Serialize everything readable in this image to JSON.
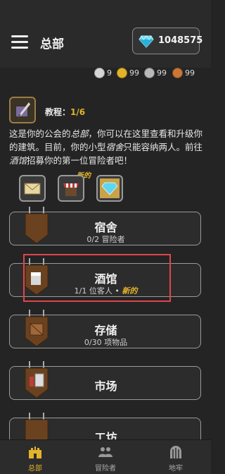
{
  "header": {
    "title": "总部",
    "gems": "1048575"
  },
  "resources": [
    {
      "icon": "silver-skull-coin-icon",
      "value": "9",
      "color": "#cfcfcf"
    },
    {
      "icon": "gold-coin-icon",
      "value": "99",
      "color": "#e3b32a"
    },
    {
      "icon": "silver-coin-icon",
      "value": "99",
      "color": "#b9b9b9"
    },
    {
      "icon": "copper-coin-icon",
      "value": "99",
      "color": "#c9783a"
    }
  ],
  "tutorial": {
    "label": "教程：",
    "progress": "1/6",
    "desc": {
      "p1": "这是你的公会的",
      "hq": "总部",
      "p2": "，你可以在这里查看和升级你的建筑。目前，你的小型",
      "dorm": "宿舍",
      "p3": "只能容纳两人。前往",
      "tavern": "酒馆",
      "p4": "招募你的第一位冒险者吧！"
    },
    "new_tag": "新的"
  },
  "buildings": [
    {
      "name": "宿舍",
      "sub": "0/2 冒险者"
    },
    {
      "name": "酒馆",
      "sub": "1/1 位客人 • ",
      "badge": "新的"
    },
    {
      "name": "存储",
      "sub": "0/30 项物品"
    },
    {
      "name": "市场",
      "sub": ""
    },
    {
      "name": "工坊",
      "sub": ""
    }
  ],
  "nav": [
    {
      "label": "总部",
      "icon": "castle-icon"
    },
    {
      "label": "冒险者",
      "icon": "people-icon"
    },
    {
      "label": "地牢",
      "icon": "dungeon-gate-icon"
    }
  ],
  "colors": {
    "accent": "#e3b32a",
    "highlight": "#e0454c",
    "background": "#242424"
  }
}
